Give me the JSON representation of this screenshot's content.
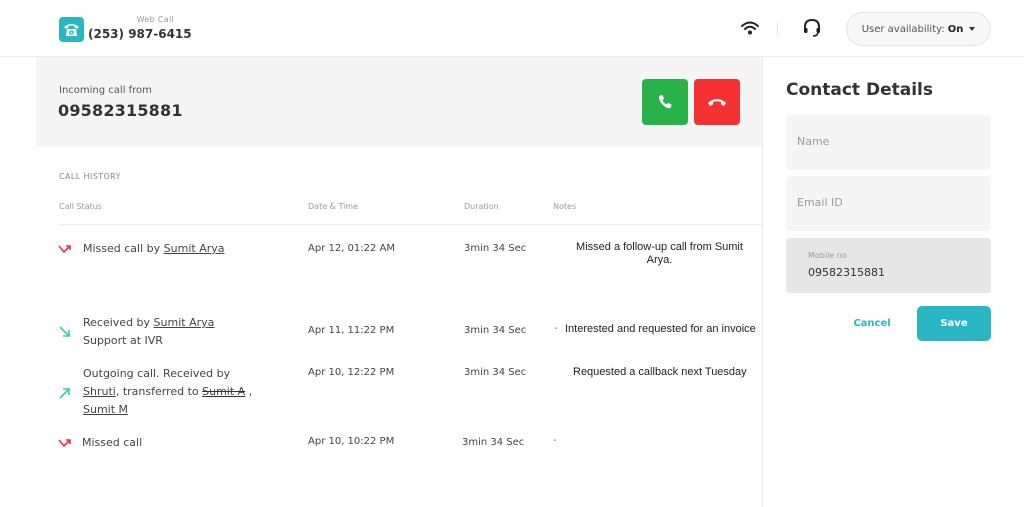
{
  "header": {
    "app_label": "Web Call",
    "phone": "(253) 987-6415",
    "icons": {
      "brand": "phone-icon",
      "network": "wifi-icon",
      "support": "headset-icon"
    },
    "availability": {
      "label": "User availability:",
      "value": "On"
    }
  },
  "incoming": {
    "label": "Incoming call from",
    "number": "09582315881",
    "accept_icon": "phone-accept-icon",
    "reject_icon": "phone-hangup-icon",
    "colors": {
      "accept": "#29b24a",
      "reject": "#f43232"
    }
  },
  "call_history": {
    "title": "CALL HISTORY",
    "columns": [
      "Call Status",
      "Date & Time",
      "Duration",
      "Notes"
    ],
    "rows": [
      {
        "type": "missed",
        "status": {
          "prefix": "Missed call by ",
          "name": "Sumit Arya"
        },
        "datetime": "Apr 12, 01:22 AM",
        "duration": "3min 34 Sec",
        "note": "Missed a follow-up call from Sumit Arya."
      },
      {
        "type": "received",
        "status": {
          "prefix": "Received by ",
          "name": "Sumit Arya ",
          "line2": "Support at IVR"
        },
        "datetime": "Apr 11, 11:22 PM",
        "duration": "3min 34 Sec",
        "dash": "-",
        "note": "Interested and requested for an invoice"
      },
      {
        "type": "outgoing",
        "status": {
          "line1": "Outgoing call. Received by",
          "name1": "Shruti",
          "mid": ", transferred to ",
          "name2": "Sumit A",
          "sep": " ,",
          "name3": "Sumit M"
        },
        "datetime": "Apr 10, 12:22 PM",
        "duration": "3min 34 Sec",
        "note": "Requested a callback next Tuesday"
      },
      {
        "type": "missed",
        "status": {
          "prefix": "Missed call"
        },
        "datetime": "Apr 10, 10:22 PM",
        "duration": "3min 34 Sec",
        "dash": "-"
      }
    ],
    "colors": {
      "missed": "#e0344a",
      "received": "#3dc9a6",
      "outgoing": "#3dc9a6"
    }
  },
  "contact": {
    "title": "Contact Details",
    "name_placeholder": "Name",
    "email_placeholder": "Email ID",
    "mobile_label": "Mobile no",
    "mobile_value": "09582315881",
    "cancel_label": "Cancel",
    "save_label": "Save",
    "accent": "#2bb6c4"
  }
}
